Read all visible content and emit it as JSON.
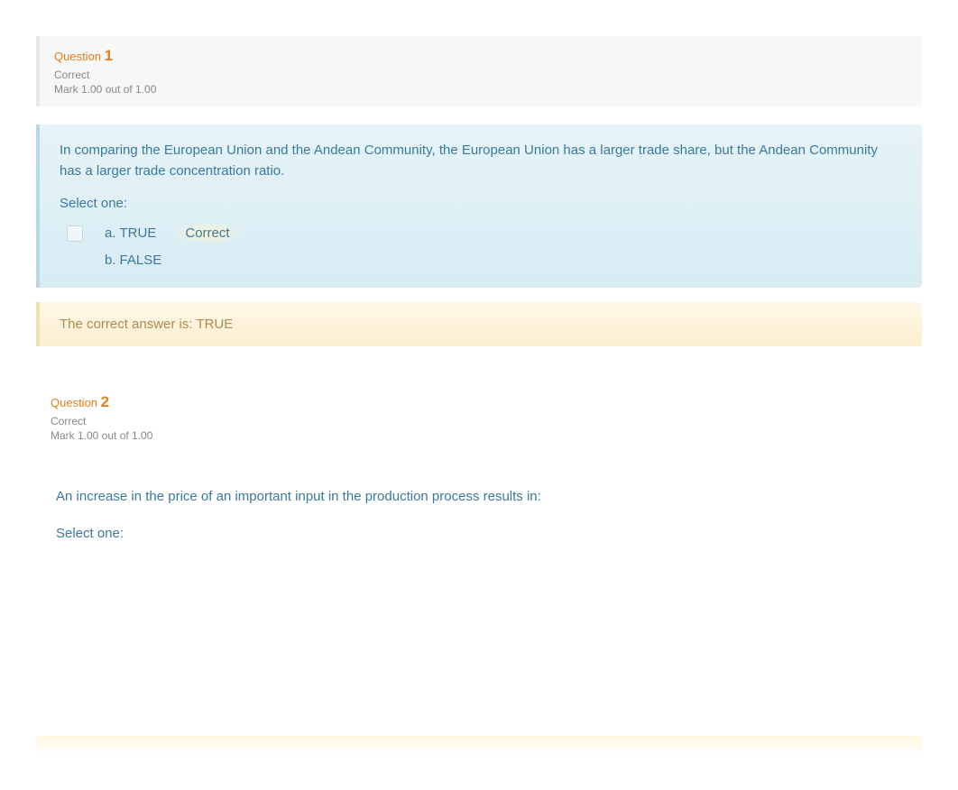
{
  "questions": [
    {
      "label": "Question",
      "number": "1",
      "status": "Correct",
      "mark": "Mark 1.00 out of 1.00",
      "text": "In comparing the European Union and the Andean Community, the European Union has a larger trade share, but the Andean Community has a larger trade concentration ratio.",
      "selectPrompt": "Select one:",
      "options": [
        {
          "letter": "a.",
          "text": "TRUE",
          "selected": true,
          "correct": true
        },
        {
          "letter": "b.",
          "text": "FALSE",
          "selected": false,
          "correct": false
        }
      ],
      "correctLabel": "Correct",
      "feedback": "The correct answer is: TRUE"
    },
    {
      "label": "Question",
      "number": "2",
      "status": "Correct",
      "mark": "Mark 1.00 out of 1.00",
      "text": "An increase in the price of an important input in the production process results in:",
      "selectPrompt": "Select one:"
    }
  ]
}
